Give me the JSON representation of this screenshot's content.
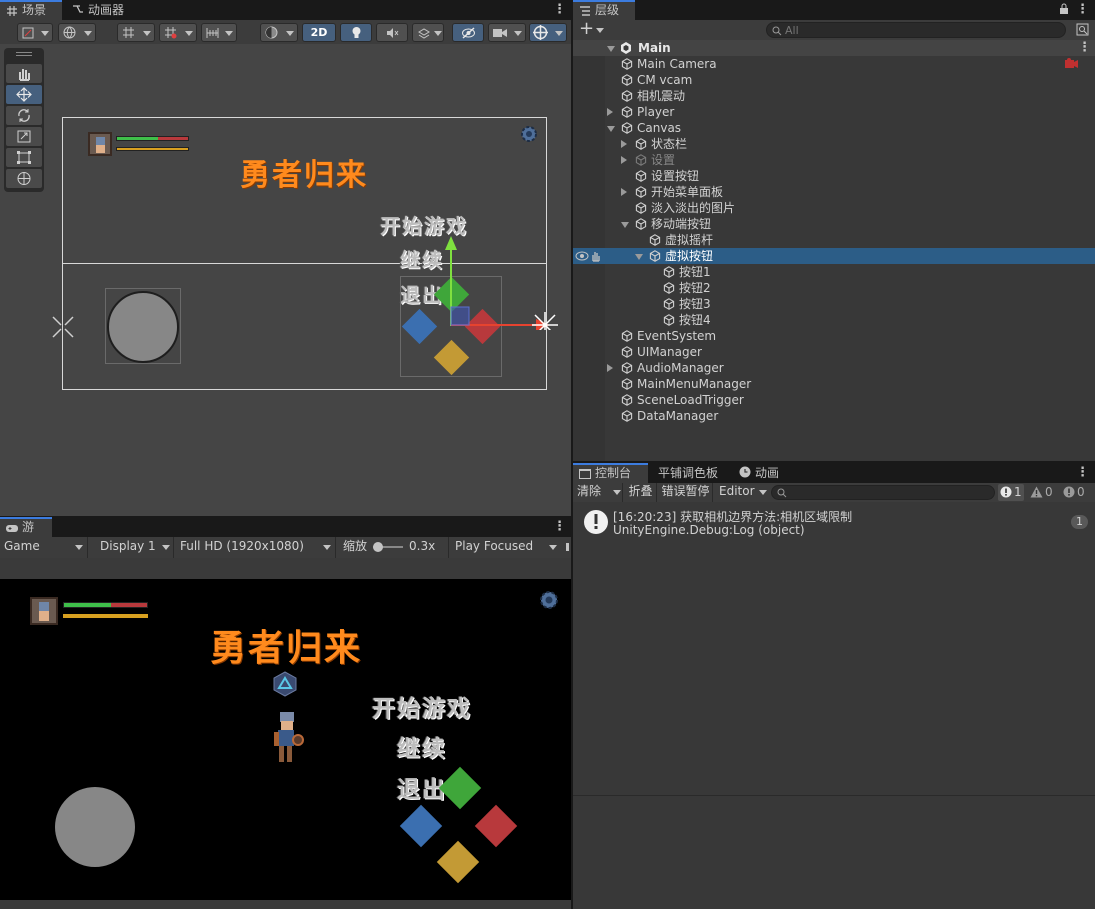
{
  "scene_tabs": {
    "scene": "场景",
    "animator": "动画器"
  },
  "scene_toolbar": {
    "mode_2d": "2D"
  },
  "scene_content": {
    "title": "勇者归来",
    "menu": [
      "开始游戏",
      "继续",
      "退出"
    ]
  },
  "hierarchy": {
    "tab": "层级",
    "search_placeholder": "All",
    "root": "Main",
    "items": [
      {
        "label": "Main Camera",
        "depth": 1
      },
      {
        "label": "CM vcam",
        "depth": 1
      },
      {
        "label": "相机震动",
        "depth": 1
      },
      {
        "label": "Player",
        "depth": 1
      },
      {
        "label": "Canvas",
        "depth": 1
      },
      {
        "label": "状态栏",
        "depth": 2
      },
      {
        "label": "设置",
        "depth": 2
      },
      {
        "label": "设置按钮",
        "depth": 2
      },
      {
        "label": "开始菜单面板",
        "depth": 2
      },
      {
        "label": "淡入淡出的图片",
        "depth": 2
      },
      {
        "label": "移动端按钮",
        "depth": 2
      },
      {
        "label": "虚拟摇杆",
        "depth": 3
      },
      {
        "label": "虚拟按钮",
        "depth": 3
      },
      {
        "label": "按钮1",
        "depth": 4
      },
      {
        "label": "按钮2",
        "depth": 4
      },
      {
        "label": "按钮3",
        "depth": 4
      },
      {
        "label": "按钮4",
        "depth": 4
      },
      {
        "label": "EventSystem",
        "depth": 1
      },
      {
        "label": "UIManager",
        "depth": 1
      },
      {
        "label": "AudioManager",
        "depth": 1
      },
      {
        "label": "MainMenuManager",
        "depth": 1
      },
      {
        "label": "SceneLoadTrigger",
        "depth": 1
      },
      {
        "label": "DataManager",
        "depth": 1
      }
    ]
  },
  "console": {
    "tabs": [
      "控制台",
      "平铺调色板",
      "动画"
    ],
    "toolbar": {
      "clear": "清除",
      "collapse": "折叠",
      "error_pause": "错误暂停",
      "editor": "Editor"
    },
    "counts": {
      "log": "1",
      "warn": "0",
      "error": "0"
    },
    "entry": {
      "line1": "[16:20:23] 获取相机边界方法:相机区域限制",
      "line2": "UnityEngine.Debug:Log (object)",
      "count": "1"
    }
  },
  "game": {
    "tab": "游戏",
    "toolbar": {
      "game": "Game",
      "display": "Display 1",
      "resolution": "Full HD (1920x1080)",
      "scale_label": "缩放",
      "scale_value": "0.3x",
      "play_focused": "Play Focused"
    },
    "title": "勇者归来",
    "menu": [
      "开始游戏",
      "继续",
      "退出"
    ]
  },
  "colors": {
    "accent": "#2c5d87",
    "title_orange": "#ff8a1d",
    "btn_green": "#3fa63a",
    "btn_red": "#b8393c",
    "btn_blue": "#3b6fb0",
    "btn_yellow": "#c39a35"
  }
}
